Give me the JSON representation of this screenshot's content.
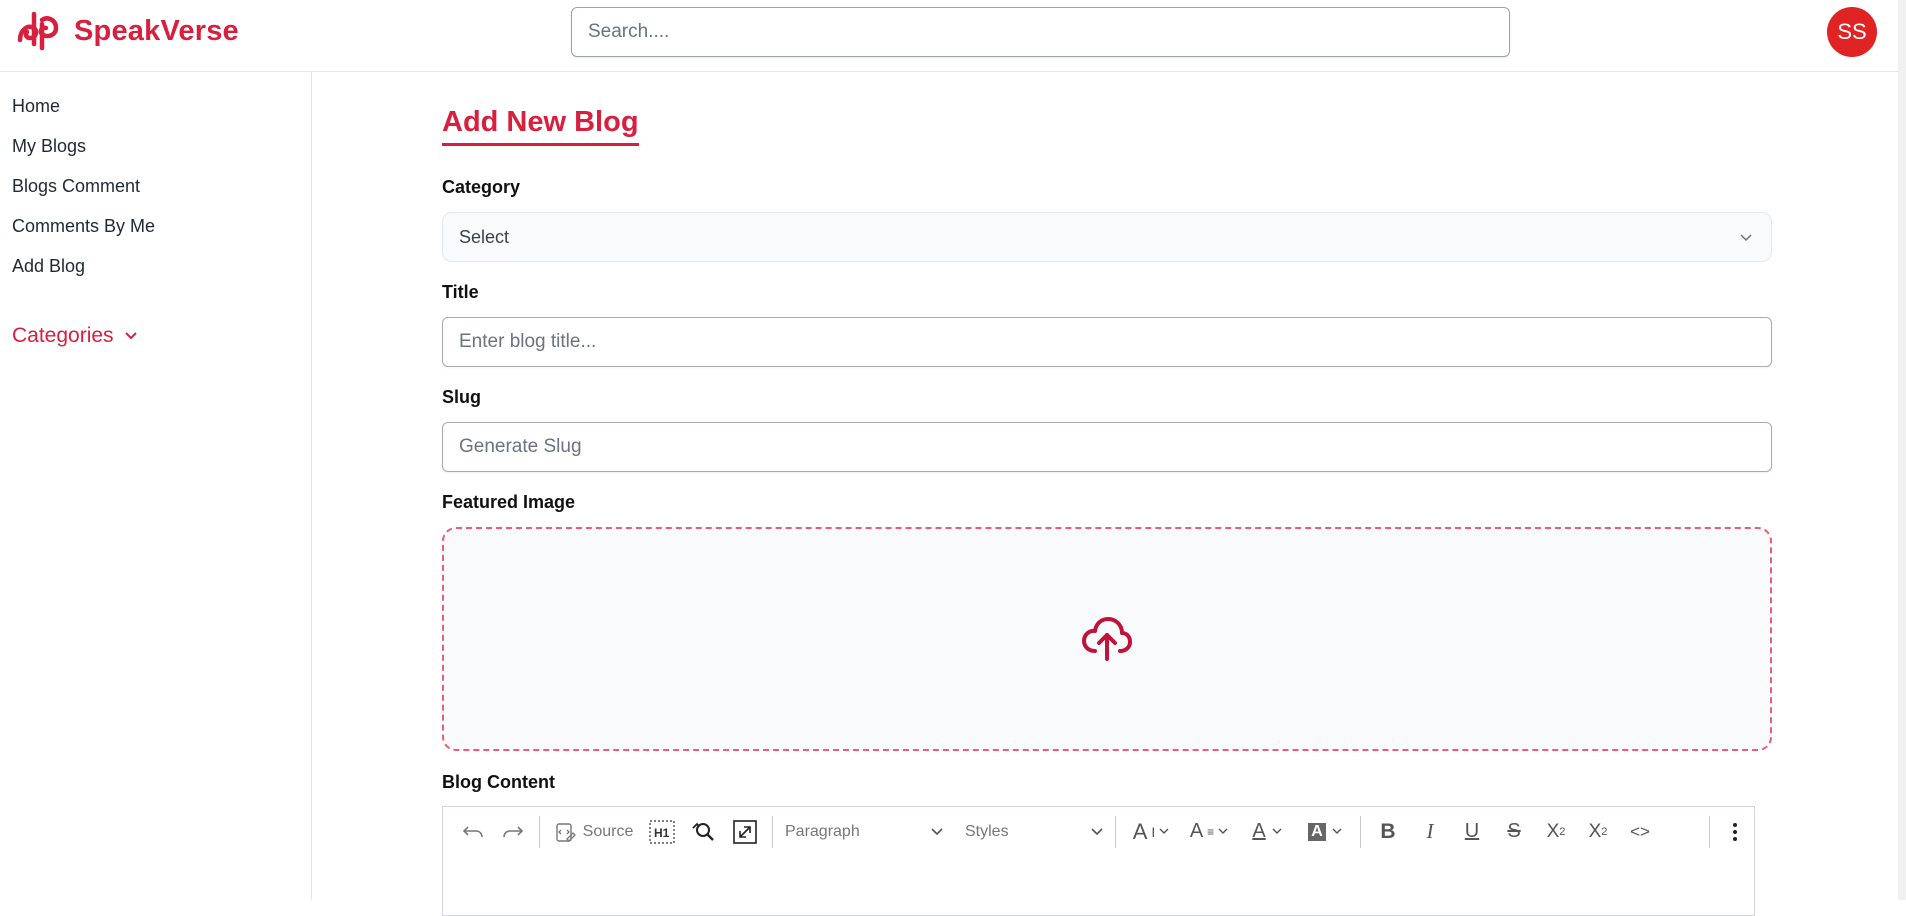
{
  "header": {
    "brand": "SpeakVerse",
    "search_placeholder": "Search....",
    "avatar_initials": "SS",
    "brand_color": "#d81f3e",
    "avatar_color": "#e02424"
  },
  "sidebar": {
    "items": [
      {
        "label": "Home"
      },
      {
        "label": "My Blogs"
      },
      {
        "label": "Blogs Comment"
      },
      {
        "label": "Comments By Me"
      },
      {
        "label": "Add Blog"
      }
    ],
    "categories_label": "Categories"
  },
  "form": {
    "page_title": "Add New Blog",
    "category_label": "Category",
    "category_value": "Select",
    "title_label": "Title",
    "title_placeholder": "Enter blog title...",
    "slug_label": "Slug",
    "slug_placeholder": "Generate Slug",
    "featured_image_label": "Featured Image",
    "content_label": "Blog Content"
  },
  "toolbar": {
    "source_label": "Source",
    "paragraph_label": "Paragraph",
    "styles_label": "Styles",
    "icons": [
      "undo-icon",
      "redo-icon",
      "source-icon",
      "heading-icon",
      "find-replace-icon",
      "fullscreen-icon",
      "font-size-icon",
      "font-family-icon",
      "font-color-icon",
      "font-background-icon",
      "bold-icon",
      "italic-icon",
      "underline-icon",
      "strikethrough-icon",
      "subscript-icon",
      "superscript-icon",
      "code-icon",
      "more-icon"
    ]
  }
}
